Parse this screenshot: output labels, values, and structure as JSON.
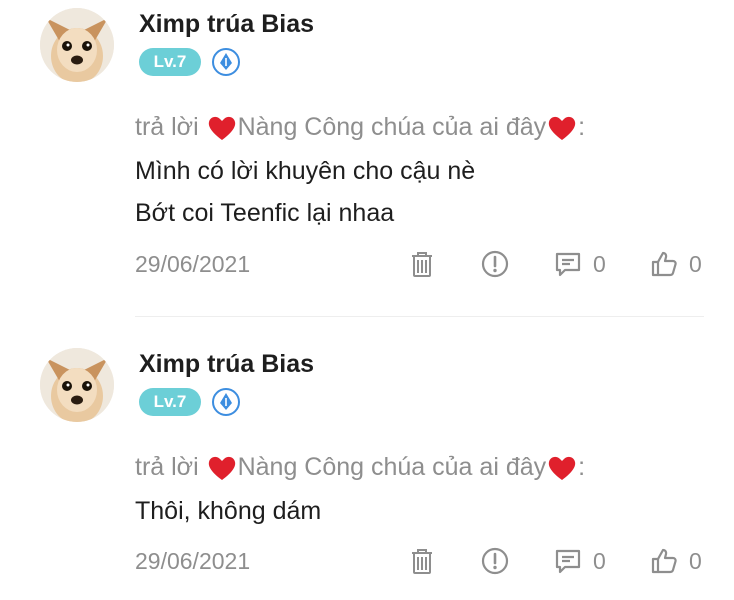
{
  "comments": [
    {
      "username": "Ximp trúa Bias",
      "level": "Lv.7",
      "reply_prefix": "trả lời",
      "reply_target": "Nàng Công chúa của ai đây",
      "reply_suffix": ":",
      "body_lines": [
        "Mình có lời khuyên cho cậu nè",
        "Bớt coi Teenfic lại nhaa"
      ],
      "date": "29/06/2021",
      "reply_count": "0",
      "like_count": "0"
    },
    {
      "username": "Ximp trúa Bias",
      "level": "Lv.7",
      "reply_prefix": "trả lời",
      "reply_target": "Nàng Công chúa của ai đây",
      "reply_suffix": ":",
      "body_lines": [
        "Thôi, không dám"
      ],
      "date": "29/06/2021",
      "reply_count": "0",
      "like_count": "0"
    }
  ],
  "icons": {
    "heart": "heart-icon",
    "delete": "trash-icon",
    "report": "exclamation-icon",
    "reply": "comment-icon",
    "like": "thumbs-up-icon",
    "rank": "rank-pen-icon"
  },
  "colors": {
    "level_badge": "#6ccfd7",
    "heart": "#e0202c",
    "rank_badge": "#3d8ee0",
    "meta_text": "#8e8e8e"
  }
}
